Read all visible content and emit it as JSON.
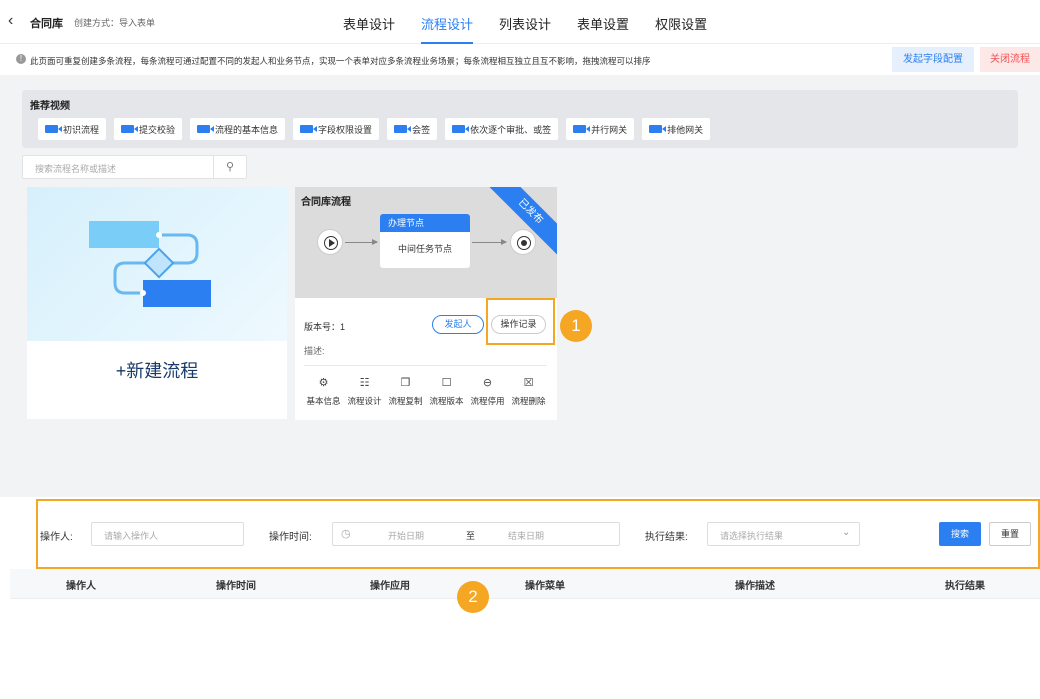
{
  "header": {
    "title": "合同库",
    "create_mode": "创建方式：导入表单",
    "tabs": [
      {
        "label": "表单设计"
      },
      {
        "label": "流程设计"
      },
      {
        "label": "列表设计"
      },
      {
        "label": "表单设置"
      },
      {
        "label": "权限设置"
      }
    ],
    "active_tab": "流程设计"
  },
  "notice": {
    "text": "此页面可重复创建多条流程，每条流程可通过配置不同的发起人和业务节点，实现一个表单对应多条流程业务场景；每条流程相互独立且互不影响，拖拽流程可以排序",
    "field_config_label": "发起字段配置",
    "close_flow_label": "关闭流程"
  },
  "recommend": {
    "title": "推荐视频",
    "videos": [
      "初识流程",
      "提交校验",
      "流程的基本信息",
      "字段权限设置",
      "会签",
      "依次逐个审批、或签",
      "并行网关",
      "排他网关"
    ]
  },
  "search": {
    "placeholder": "搜索流程名称或描述"
  },
  "new_flow": {
    "label": "+新建流程"
  },
  "flow_card": {
    "name": "合同库流程",
    "status": "已发布",
    "task_node_title": "办理节点",
    "task_node_body": "中间任务节点",
    "version": "版本号：1",
    "initiator_label": "发起人",
    "log_label": "操作记录",
    "desc": "描述:",
    "actions": [
      {
        "icon": "gear-icon",
        "label": "基本信息"
      },
      {
        "icon": "flow-icon",
        "label": "流程设计"
      },
      {
        "icon": "copy-icon",
        "label": "流程复制"
      },
      {
        "icon": "version-icon",
        "label": "流程版本"
      },
      {
        "icon": "disable-icon",
        "label": "流程停用"
      },
      {
        "icon": "trash-icon",
        "label": "流程删除"
      }
    ]
  },
  "markers": [
    "1",
    "2"
  ],
  "filter": {
    "operator_label": "操作人:",
    "operator_placeholder": "请输入操作人",
    "time_label": "操作时间:",
    "start_placeholder": "开始日期",
    "to": "至",
    "end_placeholder": "结束日期",
    "result_label": "执行结果:",
    "result_placeholder": "请选择执行结果",
    "search_label": "搜索",
    "reset_label": "重置"
  },
  "table": {
    "columns": [
      "操作人",
      "操作时间",
      "操作应用",
      "操作菜单",
      "操作描述",
      "执行结果"
    ]
  },
  "colors": {
    "accent": "#2b7ff0",
    "highlight": "#f5a623",
    "danger": "#f25252"
  }
}
